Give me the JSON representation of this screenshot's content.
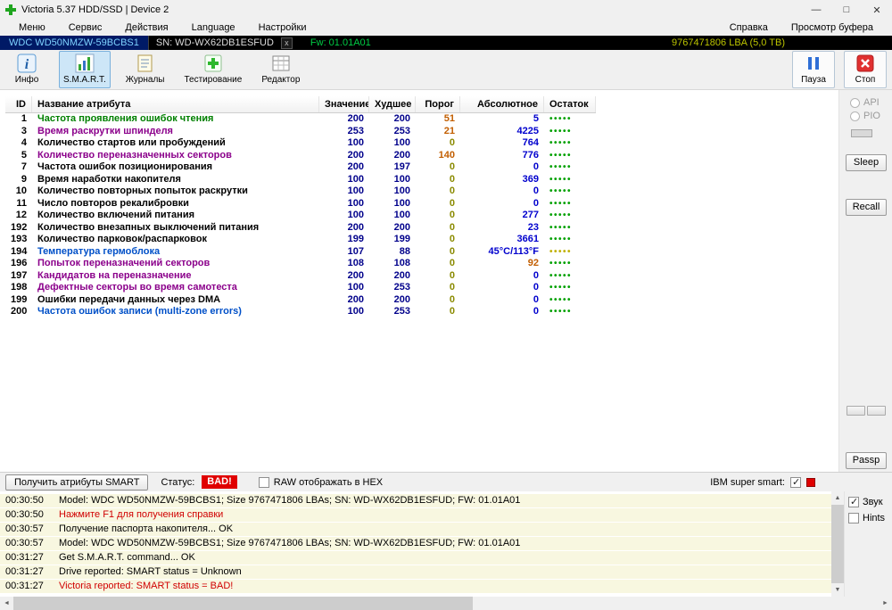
{
  "window": {
    "title": "Victoria 5.37 HDD/SSD | Device 2"
  },
  "menubar": {
    "items": [
      "Меню",
      "Сервис",
      "Действия",
      "Language",
      "Настройки"
    ],
    "help": "Справка",
    "buffer_view": "Просмотр буфера"
  },
  "device_bar": {
    "model": "WDC WD50NMZW-59BCBS1",
    "serial": "SN: WD-WX62DB1ESFUD",
    "close": "x",
    "firmware": "Fw: 01.01A01",
    "capacity": "9767471806 LBA (5,0 TB)"
  },
  "toolbar": {
    "info": "Инфо",
    "smart": "S.M.A.R.T.",
    "logs": "Журналы",
    "testing": "Тестирование",
    "editor": "Редактор",
    "pause": "Пауза",
    "stop": "Стоп"
  },
  "side_panel": {
    "api": "API",
    "pio": "PIO",
    "sleep": "Sleep",
    "recall": "Recall",
    "passp": "Passp"
  },
  "smart_table": {
    "headers": [
      "ID",
      "Название атрибута",
      "Значение",
      "Худшее",
      "Порог",
      "Абсолютное",
      "Остаток"
    ],
    "rows": [
      {
        "id": "1",
        "name": "Частота проявления ошибок чтения",
        "name_color": "green",
        "value": "200",
        "worst": "200",
        "thresh": "51",
        "thresh_color": "orange",
        "abs": "5",
        "abs_color": "blue",
        "health": "•••••",
        "health_color": "green"
      },
      {
        "id": "3",
        "name": "Время раскрутки шпинделя",
        "name_color": "purple",
        "value": "253",
        "worst": "253",
        "thresh": "21",
        "thresh_color": "orange",
        "abs": "4225",
        "abs_color": "blue",
        "health": "•••••",
        "health_color": "green"
      },
      {
        "id": "4",
        "name": "Количество стартов или пробуждений",
        "name_color": "black",
        "value": "100",
        "worst": "100",
        "thresh": "0",
        "thresh_color": "olive",
        "abs": "764",
        "abs_color": "blue",
        "health": "•••••",
        "health_color": "green"
      },
      {
        "id": "5",
        "name": "Количество переназначенных секторов",
        "name_color": "purple",
        "value": "200",
        "worst": "200",
        "thresh": "140",
        "thresh_color": "orange",
        "abs": "776",
        "abs_color": "blue",
        "health": "•••••",
        "health_color": "green"
      },
      {
        "id": "7",
        "name": "Частота ошибок позиционирования",
        "name_color": "black",
        "value": "200",
        "worst": "197",
        "thresh": "0",
        "thresh_color": "olive",
        "abs": "0",
        "abs_color": "blue",
        "health": "•••••",
        "health_color": "green"
      },
      {
        "id": "9",
        "name": "Время наработки накопителя",
        "name_color": "black",
        "value": "100",
        "worst": "100",
        "thresh": "0",
        "thresh_color": "olive",
        "abs": "369",
        "abs_color": "blue",
        "health": "•••••",
        "health_color": "green"
      },
      {
        "id": "10",
        "name": "Количество повторных попыток раскрутки",
        "name_color": "black",
        "value": "100",
        "worst": "100",
        "thresh": "0",
        "thresh_color": "olive",
        "abs": "0",
        "abs_color": "blue",
        "health": "•••••",
        "health_color": "green"
      },
      {
        "id": "11",
        "name": "Число повторов рекалибровки",
        "name_color": "black",
        "value": "100",
        "worst": "100",
        "thresh": "0",
        "thresh_color": "olive",
        "abs": "0",
        "abs_color": "blue",
        "health": "•••••",
        "health_color": "green"
      },
      {
        "id": "12",
        "name": "Количество включений питания",
        "name_color": "black",
        "value": "100",
        "worst": "100",
        "thresh": "0",
        "thresh_color": "olive",
        "abs": "277",
        "abs_color": "blue",
        "health": "•••••",
        "health_color": "green"
      },
      {
        "id": "192",
        "name": "Количество внезапных выключений питания",
        "name_color": "black",
        "value": "200",
        "worst": "200",
        "thresh": "0",
        "thresh_color": "olive",
        "abs": "23",
        "abs_color": "blue",
        "health": "•••••",
        "health_color": "green"
      },
      {
        "id": "193",
        "name": "Количество парковок/распарковок",
        "name_color": "black",
        "value": "199",
        "worst": "199",
        "thresh": "0",
        "thresh_color": "olive",
        "abs": "3661",
        "abs_color": "blue",
        "health": "•••••",
        "health_color": "green"
      },
      {
        "id": "194",
        "name": "Температура гермоблока",
        "name_color": "blue",
        "value": "107",
        "worst": "88",
        "thresh": "0",
        "thresh_color": "olive",
        "abs": "45°C/113°F",
        "abs_color": "blue",
        "health": "•••••",
        "health_color": "yellow"
      },
      {
        "id": "196",
        "name": "Попыток переназначений секторов",
        "name_color": "purple",
        "value": "108",
        "worst": "108",
        "thresh": "0",
        "thresh_color": "olive",
        "abs": "92",
        "abs_color": "orange",
        "health": "•••••",
        "health_color": "green"
      },
      {
        "id": "197",
        "name": "Кандидатов на переназначение",
        "name_color": "purple",
        "value": "200",
        "worst": "200",
        "thresh": "0",
        "thresh_color": "olive",
        "abs": "0",
        "abs_color": "blue",
        "health": "•••••",
        "health_color": "green"
      },
      {
        "id": "198",
        "name": "Дефектные секторы во время самотеста",
        "name_color": "purple",
        "value": "100",
        "worst": "253",
        "thresh": "0",
        "thresh_color": "olive",
        "abs": "0",
        "abs_color": "blue",
        "health": "•••••",
        "health_color": "green"
      },
      {
        "id": "199",
        "name": "Ошибки передачи данных через DMA",
        "name_color": "black",
        "value": "200",
        "worst": "200",
        "thresh": "0",
        "thresh_color": "olive",
        "abs": "0",
        "abs_color": "blue",
        "health": "•••••",
        "health_color": "green"
      },
      {
        "id": "200",
        "name": "Частота ошибок записи (multi-zone errors)",
        "name_color": "blue",
        "value": "100",
        "worst": "253",
        "thresh": "0",
        "thresh_color": "olive",
        "abs": "0",
        "abs_color": "blue",
        "health": "•••••",
        "health_color": "green"
      }
    ]
  },
  "status_bar": {
    "get_smart_button": "Получить атрибуты SMART",
    "status_label": "Статус:",
    "status_value": "BAD!",
    "raw_hex_label": "RAW отображать в HEX",
    "ibm_label": "IBM super smart:"
  },
  "log_panel": {
    "sound_label": "Звук",
    "hints_label": "Hints",
    "entries": [
      {
        "time": "00:30:50",
        "text": "Model: WDC WD50NMZW-59BCBS1; Size 9767471806 LBAs; SN: WD-WX62DB1ESFUD; FW: 01.01A01",
        "color": "black"
      },
      {
        "time": "00:30:50",
        "text": "Нажмите F1 для получения справки",
        "color": "red"
      },
      {
        "time": "00:30:57",
        "text": "Получение паспорта накопителя... OK",
        "color": "black"
      },
      {
        "time": "00:30:57",
        "text": "Model: WDC WD50NMZW-59BCBS1; Size 9767471806 LBAs; SN: WD-WX62DB1ESFUD; FW: 01.01A01",
        "color": "black"
      },
      {
        "time": "00:31:27",
        "text": "Get S.M.A.R.T. command... OK",
        "color": "black"
      },
      {
        "time": "00:31:27",
        "text": "Drive reported: SMART status = Unknown",
        "color": "black"
      },
      {
        "time": "00:31:27",
        "text": "Victoria reported: SMART status = BAD!",
        "color": "red"
      }
    ]
  },
  "colors": {
    "status_bad": "#e00000",
    "health_good": "#00a000",
    "health_warn": "#c0b000",
    "firmware_green": "#00cc44",
    "device_tab_text": "#7fd2ff",
    "capacity_text": "#bcc400"
  }
}
